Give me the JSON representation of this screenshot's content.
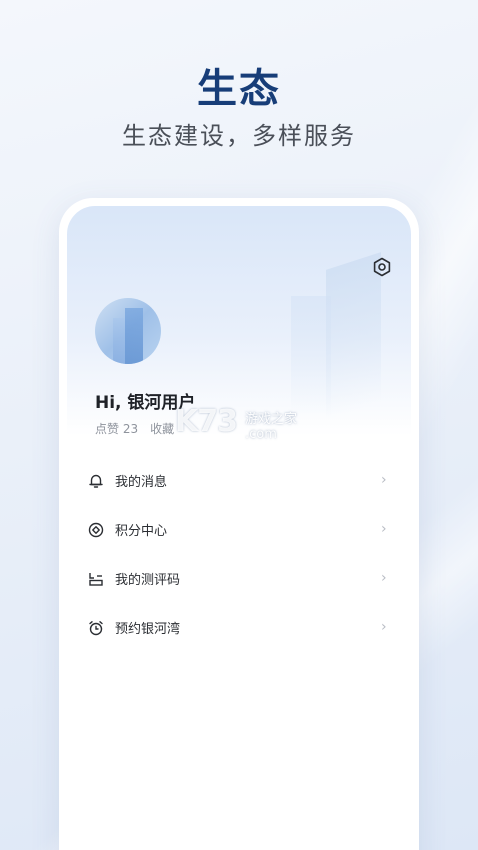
{
  "headline": {
    "title": "生态",
    "subtitle": "生态建设，多样服务"
  },
  "profile": {
    "greeting": "Hi, 银河用户",
    "stats": [
      {
        "label": "点赞",
        "value": "23"
      },
      {
        "label": "收藏",
        "value": ""
      }
    ]
  },
  "watermark": {
    "logo": "K73",
    "text": "游戏之家",
    "domain": ".com"
  },
  "menu": [
    {
      "label": "我的消息",
      "icon": "bell-icon"
    },
    {
      "label": "积分中心",
      "icon": "diamond-coin-icon"
    },
    {
      "label": "我的测评码",
      "icon": "code-grid-icon"
    },
    {
      "label": "预约银河湾",
      "icon": "alarm-clock-icon"
    }
  ],
  "colors": {
    "title": "#173d78",
    "accent_bg": "#d9e6f8"
  }
}
